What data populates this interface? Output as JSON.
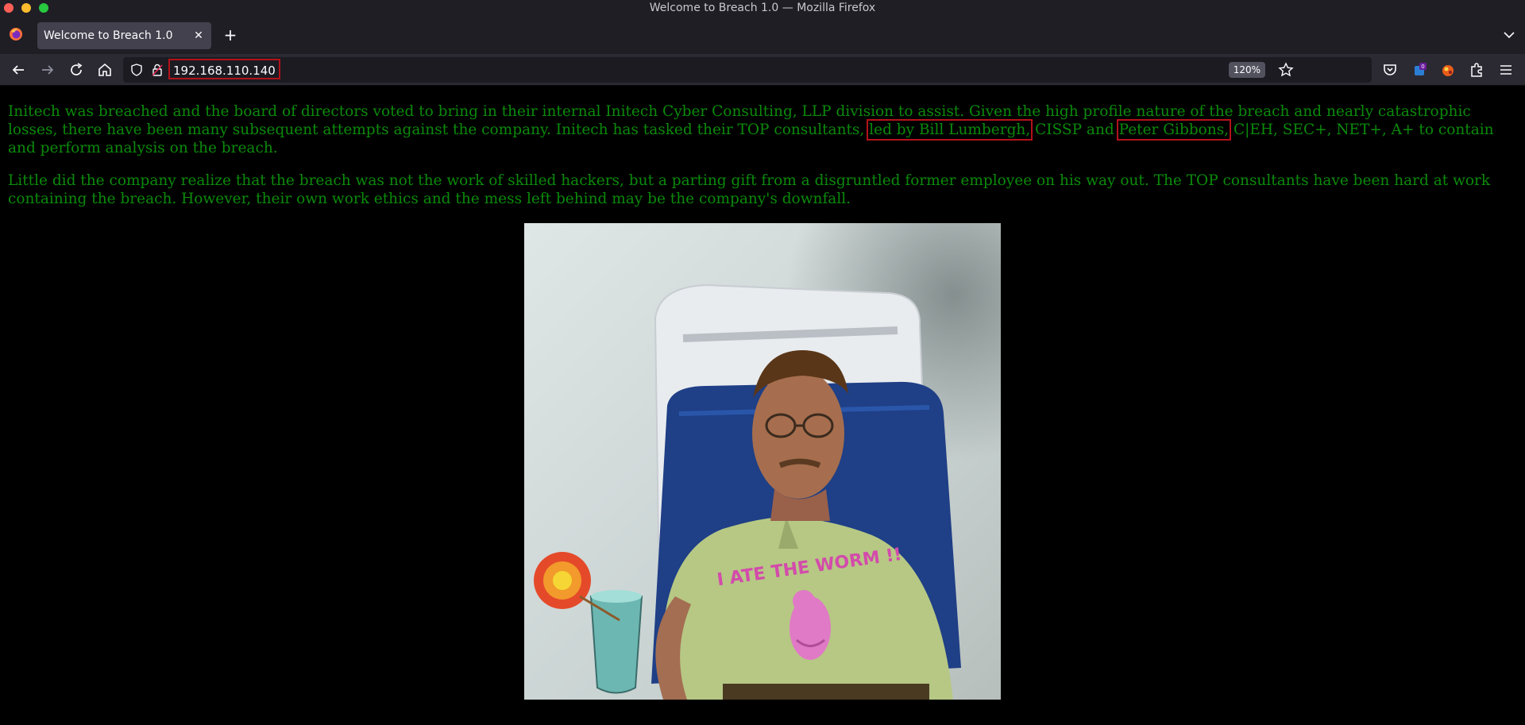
{
  "window": {
    "title": "Welcome to Breach 1.0 — Mozilla Firefox"
  },
  "tabs": [
    {
      "label": "Welcome to Breach 1.0",
      "close_glyph": "✕"
    }
  ],
  "newtab_glyph": "+",
  "urlbar": {
    "url": "192.168.110.140",
    "zoom": "120%"
  },
  "toolbar_icons": [
    "back-icon",
    "forward-icon",
    "reload-icon",
    "home-icon",
    "shield-icon",
    "lock-icon",
    "star-icon",
    "pocket-icon",
    "container-icon",
    "extension-icon",
    "puzzle-icon",
    "menu-icon"
  ],
  "badge_count": "0",
  "page": {
    "p1_a": "Initech was breached and the board of directors voted to bring in their internal Initech Cyber Consulting, LLP division to assist. Given the high profile nature of the breach and nearly catastrophic losses, there have been many subsequent attempts against the company. Initech has tasked their TOP consultants,",
    "p1_hl1": "led by Bill Lumbergh,",
    "p1_b": "CISSP and",
    "p1_hl2": "Peter Gibbons,",
    "p1_c": "C|EH, SEC+, NET+, A+ to contain and perform analysis on the breach.",
    "p2": "Little did the company realize that the breach was not the work of skilled hackers, but a parting gift from a disgruntled former employee on his way out. The TOP consultants have been hard at work containing the breach. However, their own work ethics and the mess left behind may be the company's downfall.",
    "shirt_text": "I ATE THE WORM !!"
  },
  "colors": {
    "page_text": "#0b8a0b",
    "highlight_box": "#b3121a",
    "chrome_bg": "#1f1e25",
    "nav_bg": "#2b2a33"
  }
}
